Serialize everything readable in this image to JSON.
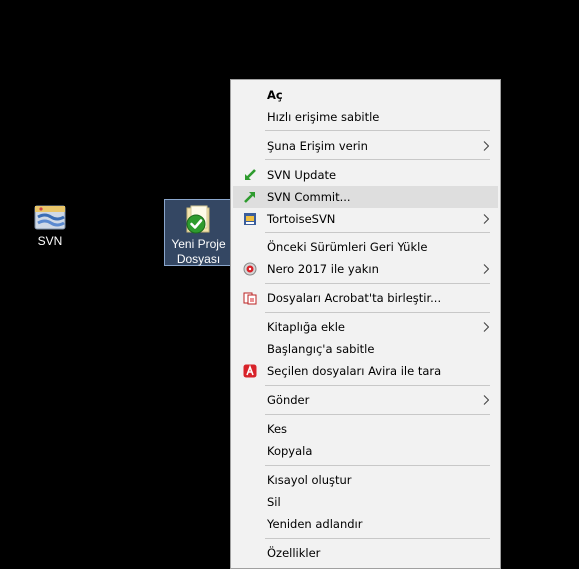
{
  "desktop": {
    "icons": [
      {
        "label": "SVN",
        "icon": "svn-shortcut-icon"
      },
      {
        "label_line1": "Yeni Proje",
        "label_line2": "Dosyası",
        "icon": "folder-svn-ok-icon"
      }
    ]
  },
  "context_menu": {
    "items": [
      {
        "label": "Aç",
        "bold": true
      },
      {
        "label": "Hızlı erişime sabitle"
      },
      {
        "label": "Şuna Erişim verin",
        "submenu": true
      },
      {
        "label": "SVN Update",
        "icon": "svn-update-icon"
      },
      {
        "label": "SVN Commit...",
        "icon": "svn-commit-icon",
        "highlighted": true
      },
      {
        "label": "TortoiseSVN",
        "icon": "tortoisesvn-icon",
        "submenu": true
      },
      {
        "label": "Önceki Sürümleri Geri Yükle"
      },
      {
        "label": "Nero 2017 ile yakın",
        "icon": "nero-icon",
        "submenu": true
      },
      {
        "label": "Dosyaları Acrobat'ta birleştir...",
        "icon": "acrobat-icon"
      },
      {
        "label": "Kitaplığa ekle",
        "submenu": true
      },
      {
        "label": "Başlangıç'a sabitle"
      },
      {
        "label": "Seçilen dosyaları Avira ile tara",
        "icon": "avira-icon"
      },
      {
        "label": "Gönder",
        "submenu": true
      },
      {
        "label": "Kes"
      },
      {
        "label": "Kopyala"
      },
      {
        "label": "Kısayol oluştur"
      },
      {
        "label": "Sil"
      },
      {
        "label": "Yeniden adlandır"
      },
      {
        "label": "Özellikler"
      }
    ]
  },
  "colors": {
    "desktop_bg": "#000000",
    "menu_bg": "#f2f2f2",
    "highlight": "#dedede",
    "svn_green": "#2e9b2e",
    "avira_red": "#d8232a"
  }
}
